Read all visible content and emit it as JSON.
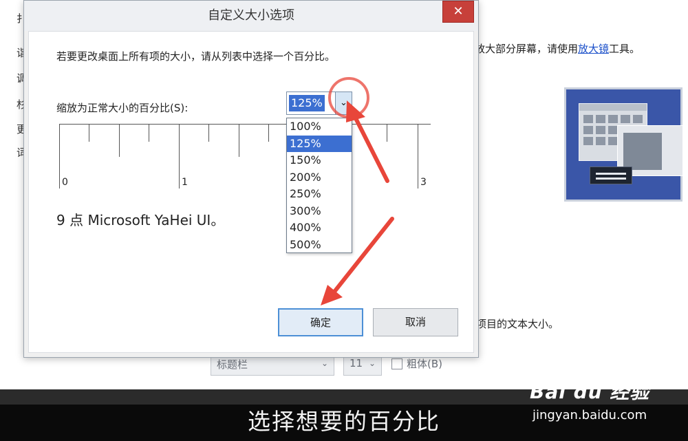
{
  "background": {
    "side_chars": [
      "扌",
      "诣",
      "调",
      "杉",
      "更",
      "词"
    ],
    "magnifier_text_prefix": "放大部分屏幕，请使用",
    "magnifier_link": "放大镜",
    "magnifier_text_suffix": "工具。",
    "text_size_text": "项目的文本大小。",
    "title_bar_select": "标题栏",
    "font_size_select": "11",
    "bold_label": "粗体(B)"
  },
  "dialog": {
    "title": "自定义大小选项",
    "close_symbol": "✕",
    "instruction": "若要更改桌面上所有项的大小，请从列表中选择一个百分比。",
    "scale_label": "缩放为正常大小的百分比(S):",
    "combo_value": "125%",
    "combo_arrow": "⌄",
    "options": [
      "100%",
      "125%",
      "150%",
      "200%",
      "250%",
      "300%",
      "400%",
      "500%"
    ],
    "selected_index": 1,
    "ruler_labels": [
      "0",
      "1",
      "3"
    ],
    "font_sample": "9 点 Microsoft YaHei UI。",
    "ok_label": "确定",
    "cancel_label": "取消"
  },
  "caption": "选择想要的百分比",
  "watermark": {
    "brand": "Bai du 经验",
    "url": "jingyan.baidu.com"
  },
  "colors": {
    "selection": "#3c6fd1",
    "close_button": "#c7403a",
    "annotation_arrow": "#e8463a",
    "link": "#1a4fc9"
  }
}
